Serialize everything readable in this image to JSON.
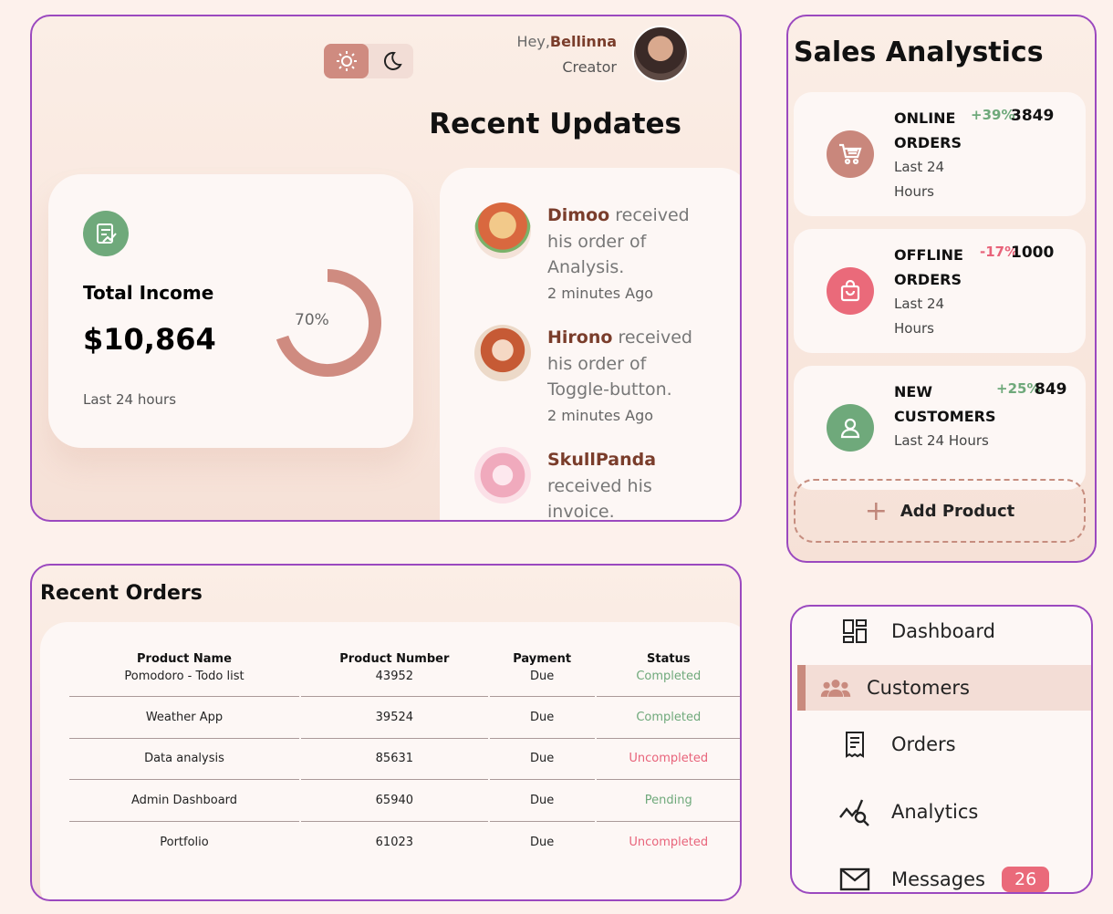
{
  "header": {
    "greeting": "Hey,",
    "user_name": "Bellinna",
    "user_role": "Creator",
    "theme_light_icon": "sun-icon",
    "theme_dark_icon": "moon-icon"
  },
  "recent_updates": {
    "title": "Recent Updates",
    "items": [
      {
        "name": "Dimoo",
        "text_after": " received his order of Analysis.",
        "time": "2 minutes Ago"
      },
      {
        "name": "Hirono",
        "text_after": " received his order of Toggle-button.",
        "time": "2 minutes Ago"
      },
      {
        "name": "SkullPanda",
        "text_after": " received his invoice.",
        "time": ""
      }
    ]
  },
  "income": {
    "title": "Total Income",
    "value": "$10,864",
    "percent_label": "70%",
    "percent": 0.7,
    "subtitle": "Last 24 hours",
    "icon": "chart-icon"
  },
  "sales": {
    "title": "Sales Analystics",
    "cards": [
      {
        "label": "ONLINE ORDERS",
        "change": "+39%",
        "value": "3849",
        "sub": "Last 24 Hours",
        "icon": "cart-icon",
        "change_color": "#6fa97b",
        "icon_color": "#c9877c"
      },
      {
        "label": "OFFLINE ORDERS",
        "change": "-17%",
        "value": "1000",
        "sub": "Last 24 Hours",
        "icon": "bag-icon",
        "change_color": "#e8637a",
        "icon_color": "#ea6a7a"
      },
      {
        "label": "NEW CUSTOMERS",
        "change": "+25%",
        "value": "849",
        "sub": "Last 24 Hours",
        "icon": "user-icon",
        "change_color": "#6fa97b",
        "icon_color": "#6fa97b"
      }
    ],
    "add_product": "Add Product"
  },
  "orders": {
    "title": "Recent Orders",
    "columns": [
      "Product Name",
      "Product Number",
      "Payment",
      "Status"
    ],
    "rows": [
      [
        "Pomodoro - Todo list",
        "43952",
        "Due",
        "Completed"
      ],
      [
        "Weather App",
        "39524",
        "Due",
        "Completed"
      ],
      [
        "Data analysis",
        "85631",
        "Due",
        "Uncompleted"
      ],
      [
        "Admin Dashboard",
        "65940",
        "Due",
        "Pending"
      ],
      [
        "Portfolio",
        "61023",
        "Due",
        "Uncompleted"
      ]
    ]
  },
  "nav": {
    "items": [
      {
        "label": "Dashboard",
        "icon": "dashboard-icon"
      },
      {
        "label": "Customers",
        "icon": "customers-icon"
      },
      {
        "label": "Orders",
        "icon": "receipt-icon"
      },
      {
        "label": "Analytics",
        "icon": "analytics-icon"
      },
      {
        "label": "Messages",
        "icon": "mail-icon",
        "badge": "26"
      }
    ]
  }
}
